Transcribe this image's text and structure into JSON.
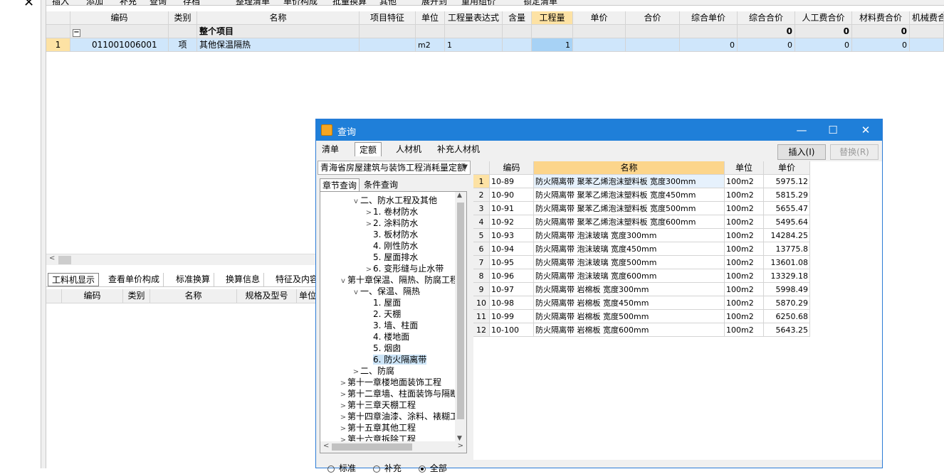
{
  "toolbar": {
    "items": [
      "插入",
      "添加",
      "补充",
      "查询",
      "存档",
      "整理清单",
      "单价构成",
      "批量换算",
      "其他",
      "展开到",
      "重用组价",
      "锁定清单"
    ]
  },
  "main_grid": {
    "headers": [
      "编码",
      "类别",
      "名称",
      "项目特征",
      "单位",
      "工程量表达式",
      "含量",
      "工程量",
      "单价",
      "合价",
      "综合单价",
      "综合合价",
      "人工费合价",
      "材料费合价",
      "机械费合价"
    ],
    "summary": {
      "toggle": "−",
      "name": "整个项目",
      "zonghe_hejia": "0",
      "rengong": "0",
      "cailiao": "0"
    },
    "rows": [
      {
        "index": "1",
        "code": "011001006001",
        "type": "项",
        "name": "其他保温隔热",
        "feature": "",
        "unit": "m2",
        "expr": "1",
        "content": "",
        "quantity": "1",
        "price": "",
        "total": "",
        "zonghe_danjia": "0",
        "zonghe_hejia": "0",
        "rengong": "0",
        "cailiao": "0"
      }
    ]
  },
  "lower_tabs": [
    "工料机显示",
    "查看单价构成",
    "标准换算",
    "换算信息",
    "特征及内容"
  ],
  "lower_grid": {
    "headers": [
      "编码",
      "类别",
      "名称",
      "规格及型号",
      "单位"
    ]
  },
  "dialog": {
    "title": "查询",
    "tabs": [
      "清单",
      "定额",
      "人材机",
      "补充人材机"
    ],
    "active_tab": "定额",
    "insert_label": "插入(I)",
    "replace_label": "替换(R)",
    "combo_value": "青海省房屋建筑与装饰工程消耗量定额",
    "subtabs": [
      "章节查询",
      "条件查询"
    ],
    "tree": [
      {
        "label": "二、防水工程及其他",
        "level": 2,
        "toggle": "v"
      },
      {
        "label": "1. 卷材防水",
        "level": 3,
        "toggle": ">"
      },
      {
        "label": "2. 涂料防水",
        "level": 3,
        "toggle": ">"
      },
      {
        "label": "3. 板材防水",
        "level": 3,
        "toggle": ""
      },
      {
        "label": "4. 刚性防水",
        "level": 3,
        "toggle": ""
      },
      {
        "label": "5. 屋面排水",
        "level": 3,
        "toggle": ""
      },
      {
        "label": "6. 变形缝与止水带",
        "level": 3,
        "toggle": ">"
      },
      {
        "label": "第十章保温、隔热、防腐工程",
        "level": 1,
        "toggle": "v"
      },
      {
        "label": "一、保温、隔热",
        "level": 2,
        "toggle": "v"
      },
      {
        "label": "1. 屋面",
        "level": 3,
        "toggle": ""
      },
      {
        "label": "2. 天棚",
        "level": 3,
        "toggle": ""
      },
      {
        "label": "3. 墙、柱面",
        "level": 3,
        "toggle": ""
      },
      {
        "label": "4. 楼地面",
        "level": 3,
        "toggle": ""
      },
      {
        "label": "5. 烟囱",
        "level": 3,
        "toggle": ""
      },
      {
        "label": "6. 防火隔离带",
        "level": 3,
        "toggle": "",
        "selected": true
      },
      {
        "label": "二、防腐",
        "level": 2,
        "toggle": ">"
      },
      {
        "label": "第十一章楼地面装饰工程",
        "level": 1,
        "toggle": ">"
      },
      {
        "label": "第十二章墙、柱面装饰与隔断",
        "level": 1,
        "toggle": ">"
      },
      {
        "label": "第十三章天棚工程",
        "level": 1,
        "toggle": ">"
      },
      {
        "label": "第十四章油漆、涂料、裱糊工程",
        "level": 1,
        "toggle": ">"
      },
      {
        "label": "第十五章其他工程",
        "level": 1,
        "toggle": ">"
      },
      {
        "label": "第十六章拆除工程",
        "level": 1,
        "toggle": ">"
      }
    ],
    "grid_headers": [
      "编码",
      "名称",
      "单位",
      "单价"
    ],
    "grid_rows": [
      {
        "i": "1",
        "code": "10-89",
        "name": "防火隔离带 聚苯乙烯泡沫塑料板 宽度300mm",
        "unit": "100m2",
        "price": "5975.12"
      },
      {
        "i": "2",
        "code": "10-90",
        "name": "防火隔离带 聚苯乙烯泡沫塑料板 宽度450mm",
        "unit": "100m2",
        "price": "5815.29"
      },
      {
        "i": "3",
        "code": "10-91",
        "name": "防火隔离带 聚苯乙烯泡沫塑料板 宽度500mm",
        "unit": "100m2",
        "price": "5655.47"
      },
      {
        "i": "4",
        "code": "10-92",
        "name": "防火隔离带 聚苯乙烯泡沫塑料板 宽度600mm",
        "unit": "100m2",
        "price": "5495.64"
      },
      {
        "i": "5",
        "code": "10-93",
        "name": "防火隔离带 泡沫玻璃 宽度300mm",
        "unit": "100m2",
        "price": "14284.25"
      },
      {
        "i": "6",
        "code": "10-94",
        "name": "防火隔离带 泡沫玻璃 宽度450mm",
        "unit": "100m2",
        "price": "13775.8"
      },
      {
        "i": "7",
        "code": "10-95",
        "name": "防火隔离带 泡沫玻璃 宽度500mm",
        "unit": "100m2",
        "price": "13601.08"
      },
      {
        "i": "8",
        "code": "10-96",
        "name": "防火隔离带 泡沫玻璃 宽度600mm",
        "unit": "100m2",
        "price": "13329.18"
      },
      {
        "i": "9",
        "code": "10-97",
        "name": "防火隔离带 岩棉板 宽度300mm",
        "unit": "100m2",
        "price": "5998.49"
      },
      {
        "i": "10",
        "code": "10-98",
        "name": "防火隔离带 岩棉板 宽度450mm",
        "unit": "100m2",
        "price": "5870.29"
      },
      {
        "i": "11",
        "code": "10-99",
        "name": "防火隔离带 岩棉板 宽度500mm",
        "unit": "100m2",
        "price": "6250.68"
      },
      {
        "i": "12",
        "code": "10-100",
        "name": "防火隔离带 岩棉板 宽度600mm",
        "unit": "100m2",
        "price": "5643.25"
      }
    ],
    "radios": [
      {
        "label": "标准",
        "checked": false
      },
      {
        "label": "补充",
        "checked": false
      },
      {
        "label": "全部",
        "checked": true
      }
    ]
  },
  "colors": {
    "titlebar": "#1f7fd9",
    "header_active": "#fde2a4",
    "selected_row": "#cfe6fb"
  }
}
